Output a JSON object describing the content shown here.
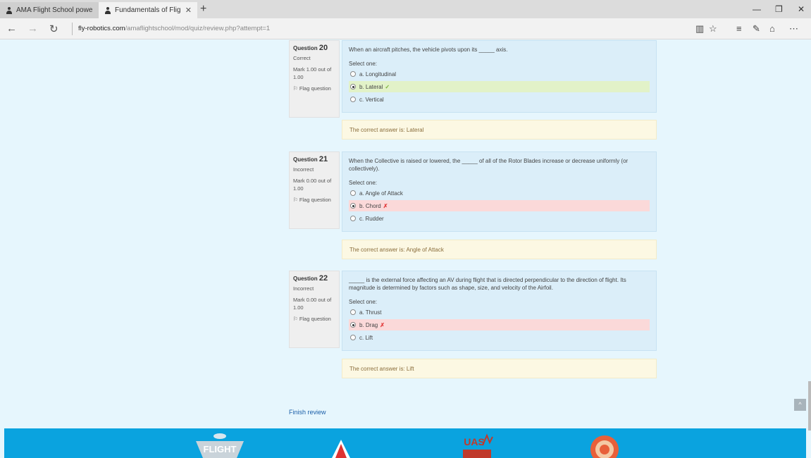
{
  "browser": {
    "tabs": [
      {
        "title": "AMA Flight School powerec",
        "active": false
      },
      {
        "title": "Fundamentals of Flight",
        "active": true
      }
    ],
    "url_host": "fly-robotics.com",
    "url_path": "/amaflightschool/mod/quiz/review.php?attempt=1"
  },
  "questions": [
    {
      "no_label": "Question",
      "no": "20",
      "state": "Correct",
      "mark": "Mark 1.00 out of 1.00",
      "flag": "Flag question",
      "text": "When an aircraft pitches, the vehicle pivots upon its _____ axis.",
      "select_label": "Select one:",
      "options": [
        {
          "label": "a. Longitudinal",
          "selected": false,
          "result": ""
        },
        {
          "label": "b. Lateral",
          "selected": true,
          "result": "correct",
          "mark": "✓"
        },
        {
          "label": "c. Vertical",
          "selected": false,
          "result": ""
        }
      ],
      "feedback": "The correct answer is: Lateral"
    },
    {
      "no_label": "Question",
      "no": "21",
      "state": "Incorrect",
      "mark": "Mark 0.00 out of 1.00",
      "flag": "Flag question",
      "text": "When the Collective is raised or lowered, the _____ of all of the Rotor Blades increase or decrease uniformly (or collectively).",
      "select_label": "Select one:",
      "options": [
        {
          "label": "a. Angle of Attack",
          "selected": false,
          "result": ""
        },
        {
          "label": "b. Chord",
          "selected": true,
          "result": "wrong",
          "mark": "✗"
        },
        {
          "label": "c. Rudder",
          "selected": false,
          "result": ""
        }
      ],
      "feedback": "The correct answer is: Angle of Attack"
    },
    {
      "no_label": "Question",
      "no": "22",
      "state": "Incorrect",
      "mark": "Mark 0.00 out of 1.00",
      "flag": "Flag question",
      "text": "_____ is the external force affecting an AV during flight that is directed perpendicular to the direction of flight. Its magnitude is determined by factors such as shape, size, and velocity of the Airfoil.",
      "select_label": "Select one:",
      "options": [
        {
          "label": "a. Thrust",
          "selected": false,
          "result": ""
        },
        {
          "label": "b. Drag",
          "selected": true,
          "result": "wrong",
          "mark": "✗"
        },
        {
          "label": "c. Lift",
          "selected": false,
          "result": ""
        }
      ],
      "feedback": "The correct answer is: Lift"
    }
  ],
  "finish_review": "Finish review",
  "footer": {
    "logo_flight_text": "FLIGHT",
    "logo_uas_text": "UAS"
  },
  "colors": {
    "page_bg": "#e6f6fd",
    "question_bg": "#dbeef9",
    "feedback_bg": "#fcf8e3",
    "footer_bg": "#0aa3df"
  }
}
